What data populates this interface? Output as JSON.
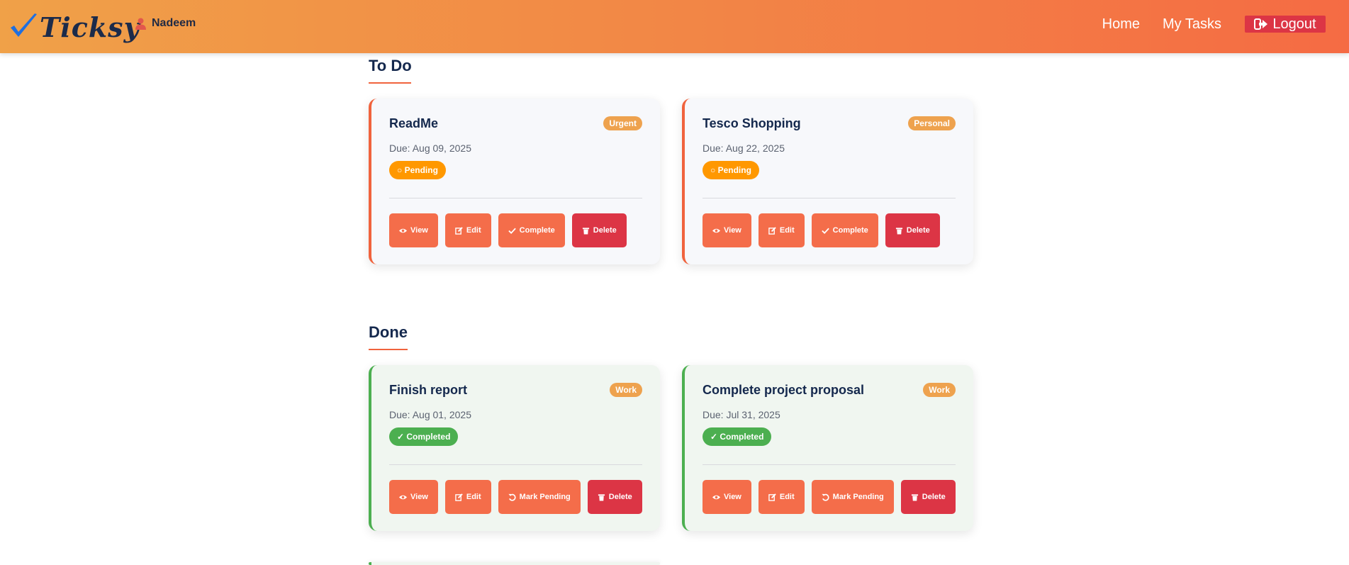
{
  "brand": {
    "name": "Ticksy"
  },
  "user": {
    "name": "Nadeem"
  },
  "nav": {
    "home": "Home",
    "my_tasks": "My Tasks",
    "logout": "Logout"
  },
  "colors": {
    "accent": "#f37c45",
    "danger": "#dc3545",
    "pending": "#ff9800",
    "completed": "#4caf50",
    "tag": "#eea24e"
  },
  "sections": {
    "todo": {
      "title": "To Do",
      "cards": [
        {
          "title": "ReadMe",
          "tag": "Urgent",
          "due": "Due: Aug 09, 2025",
          "status": "○ Pending",
          "actions": {
            "view": "View",
            "edit": "Edit",
            "complete": "Complete",
            "delete": "Delete"
          }
        },
        {
          "title": "Tesco Shopping",
          "tag": "Personal",
          "due": "Due: Aug 22, 2025",
          "status": "○ Pending",
          "actions": {
            "view": "View",
            "edit": "Edit",
            "complete": "Complete",
            "delete": "Delete"
          }
        }
      ]
    },
    "done": {
      "title": "Done",
      "cards": [
        {
          "title": "Finish report",
          "tag": "Work",
          "due": "Due: Aug 01, 2025",
          "status": "✓ Completed",
          "actions": {
            "view": "View",
            "edit": "Edit",
            "mark_pending": "Mark Pending",
            "delete": "Delete"
          }
        },
        {
          "title": "Complete project proposal",
          "tag": "Work",
          "due": "Due: Jul 31, 2025",
          "status": "✓ Completed",
          "actions": {
            "view": "View",
            "edit": "Edit",
            "mark_pending": "Mark Pending",
            "delete": "Delete"
          }
        }
      ]
    }
  }
}
